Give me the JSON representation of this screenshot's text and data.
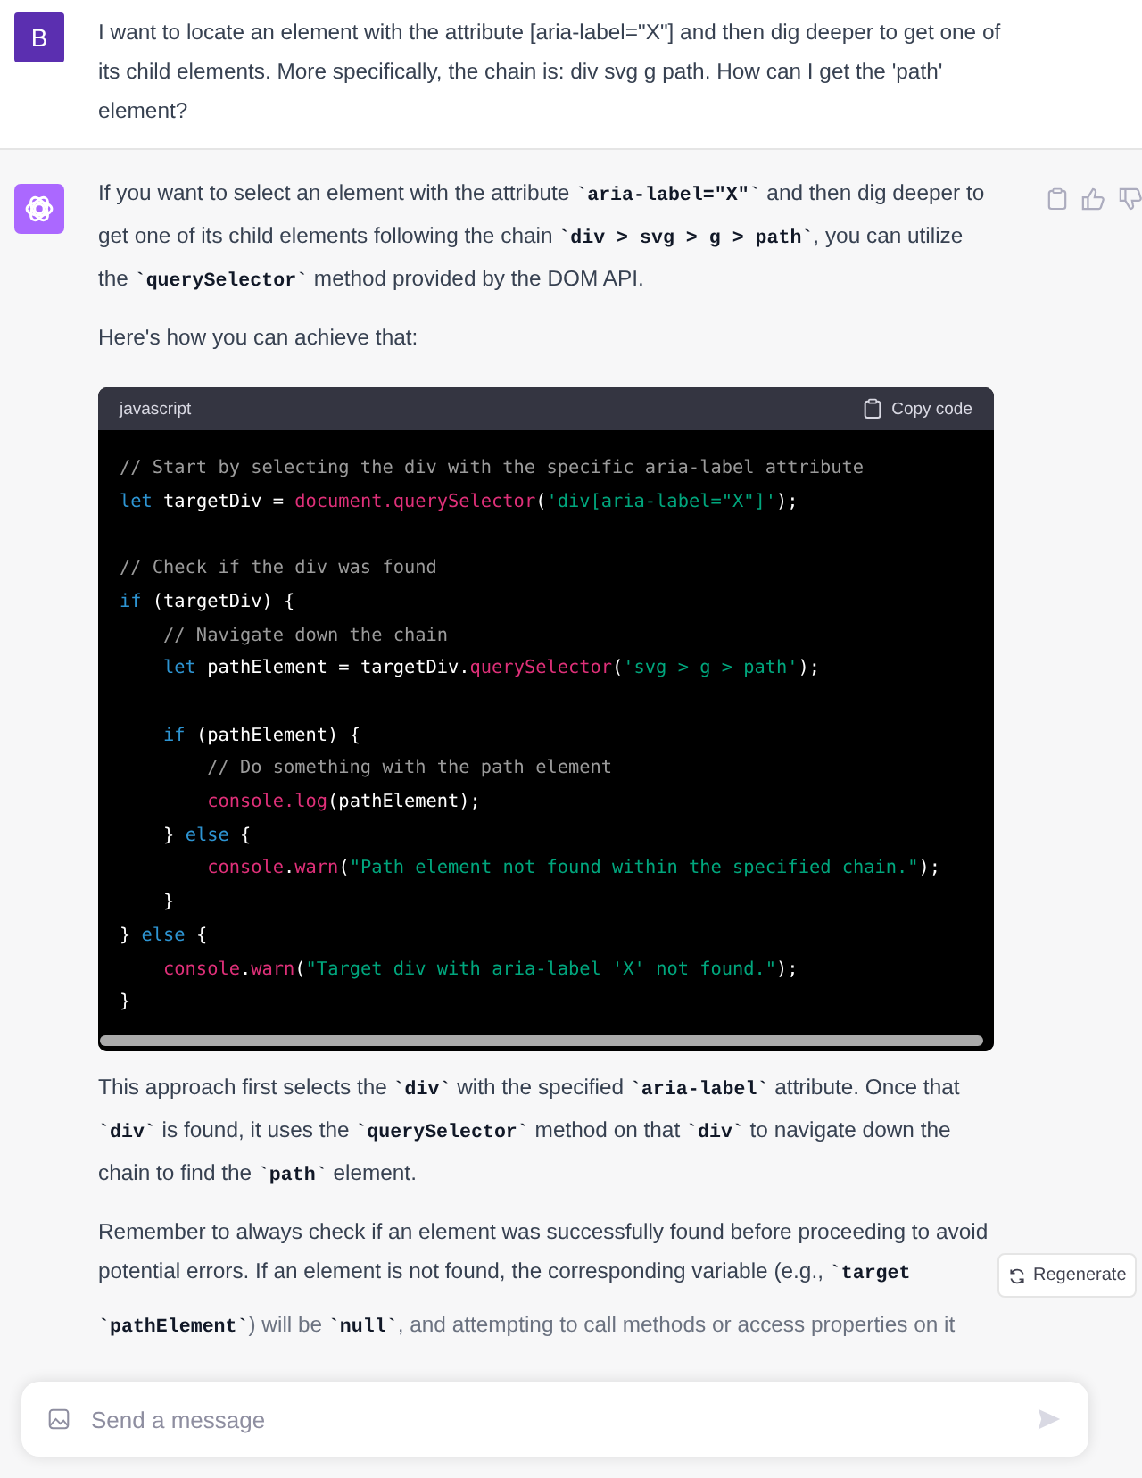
{
  "user_message": {
    "avatar": "B",
    "text": "I want to locate an element with the attribute [aria-label=\"X\"] and then dig deeper to get one of its child elements. More specifically, the chain is: div svg g path. How can I get the 'path' element?"
  },
  "assistant_message": {
    "paragraphs_before": [
      [
        {
          "kind": "text",
          "text": "If you want to select an element with the attribute "
        },
        {
          "kind": "code",
          "text": "`aria-label=\"X\"`"
        },
        {
          "kind": "text",
          "text": " and then dig deeper to get one of its child elements following the chain "
        },
        {
          "kind": "code",
          "text": "`div > svg > g > path`"
        },
        {
          "kind": "text",
          "text": ", you can utilize the "
        },
        {
          "kind": "code",
          "text": "`querySelector`"
        },
        {
          "kind": "text",
          "text": " method provided by the DOM API."
        }
      ],
      [
        {
          "kind": "text",
          "text": "Here's how you can achieve that:"
        }
      ]
    ],
    "code_block": {
      "language": "javascript",
      "copy_label": "Copy code",
      "lines": [
        {
          "tokens": [
            {
              "kind": "comment",
              "text": "// Start by selecting the div with the specific aria-label attribute"
            }
          ]
        },
        {
          "tokens": [
            {
              "kind": "keyword",
              "text": "let"
            },
            {
              "kind": "plain",
              "text": " targetDiv = "
            },
            {
              "kind": "call",
              "text": "document."
            },
            {
              "kind": "call",
              "text": "querySelector"
            },
            {
              "kind": "plain",
              "text": "("
            },
            {
              "kind": "string",
              "text": "'div[aria-label=\"X\"]'"
            },
            {
              "kind": "plain",
              "text": ");"
            }
          ]
        },
        {
          "kind": "blank"
        },
        {
          "tokens": [
            {
              "kind": "comment",
              "text": "// Check if the div was found"
            }
          ]
        },
        {
          "tokens": [
            {
              "kind": "keyword",
              "text": "if"
            },
            {
              "kind": "plain",
              "text": " (targetDiv) {"
            }
          ]
        },
        {
          "tokens": [
            {
              "kind": "comment",
              "text": "    // Navigate down the chain"
            }
          ]
        },
        {
          "tokens": [
            {
              "kind": "keyword",
              "text": "    let"
            },
            {
              "kind": "plain",
              "text": " pathElement = targetDiv."
            },
            {
              "kind": "call",
              "text": "querySelector"
            },
            {
              "kind": "plain",
              "text": "("
            },
            {
              "kind": "string",
              "text": "'svg > g > path'"
            },
            {
              "kind": "plain",
              "text": ");"
            }
          ]
        },
        {
          "kind": "blank"
        },
        {
          "tokens": [
            {
              "kind": "keyword",
              "text": "    if"
            },
            {
              "kind": "plain",
              "text": " (pathElement) {"
            }
          ]
        },
        {
          "tokens": [
            {
              "kind": "comment",
              "text": "        // Do something with the path element"
            }
          ]
        },
        {
          "tokens": [
            {
              "kind": "call",
              "text": "        console."
            },
            {
              "kind": "call",
              "text": "log"
            },
            {
              "kind": "plain",
              "text": "(pathElement);"
            }
          ]
        },
        {
          "tokens": [
            {
              "kind": "plain",
              "text": "    } "
            },
            {
              "kind": "keyword",
              "text": "else"
            },
            {
              "kind": "plain",
              "text": " {"
            }
          ]
        },
        {
          "tokens": [
            {
              "kind": "call",
              "text": "        console"
            },
            {
              "kind": "plain",
              "text": "."
            },
            {
              "kind": "call",
              "text": "warn"
            },
            {
              "kind": "plain",
              "text": "("
            },
            {
              "kind": "string",
              "text": "\"Path element not found within the specified chain.\""
            },
            {
              "kind": "plain",
              "text": ");"
            }
          ]
        },
        {
          "tokens": [
            {
              "kind": "plain",
              "text": "    }"
            }
          ]
        },
        {
          "tokens": [
            {
              "kind": "plain",
              "text": "} "
            },
            {
              "kind": "keyword",
              "text": "else"
            },
            {
              "kind": "plain",
              "text": " {"
            }
          ]
        },
        {
          "tokens": [
            {
              "kind": "call",
              "text": "    console"
            },
            {
              "kind": "plain",
              "text": "."
            },
            {
              "kind": "call",
              "text": "warn"
            },
            {
              "kind": "plain",
              "text": "("
            },
            {
              "kind": "string",
              "text": "\"Target div with aria-label 'X' not found.\""
            },
            {
              "kind": "plain",
              "text": ");"
            }
          ]
        },
        {
          "tokens": [
            {
              "kind": "plain",
              "text": "}"
            }
          ]
        }
      ]
    },
    "paragraphs_after": [
      [
        {
          "kind": "text",
          "text": "This approach first selects the "
        },
        {
          "kind": "code",
          "text": "`div`"
        },
        {
          "kind": "text",
          "text": " with the specified "
        },
        {
          "kind": "code",
          "text": "`aria-label`"
        },
        {
          "kind": "text",
          "text": " attribute. Once that "
        },
        {
          "kind": "code",
          "text": "`div`"
        },
        {
          "kind": "text",
          "text": " is found, it uses the "
        },
        {
          "kind": "code",
          "text": "`querySelector`"
        },
        {
          "kind": "text",
          "text": " method on that "
        },
        {
          "kind": "code",
          "text": "`div`"
        },
        {
          "kind": "text",
          "text": " to navigate down the chain to find the "
        },
        {
          "kind": "code",
          "text": "`path`"
        },
        {
          "kind": "text",
          "text": " element."
        }
      ],
      [
        {
          "kind": "text",
          "text": "Remember to always check if an element was successfully found before proceeding to avoid potential errors. If an element is not found, the corresponding variable (e.g., "
        },
        {
          "kind": "code",
          "text": "`target"
        }
      ],
      [
        {
          "kind": "code",
          "text": "`pathElement`"
        },
        {
          "kind": "text",
          "text": ") will be "
        },
        {
          "kind": "code",
          "text": "`null`"
        },
        {
          "kind": "text",
          "text": ", and attempting to call methods or access properties on it"
        }
      ]
    ]
  },
  "regenerate_button": "Regenerate",
  "composer": {
    "placeholder": "Send a message"
  }
}
